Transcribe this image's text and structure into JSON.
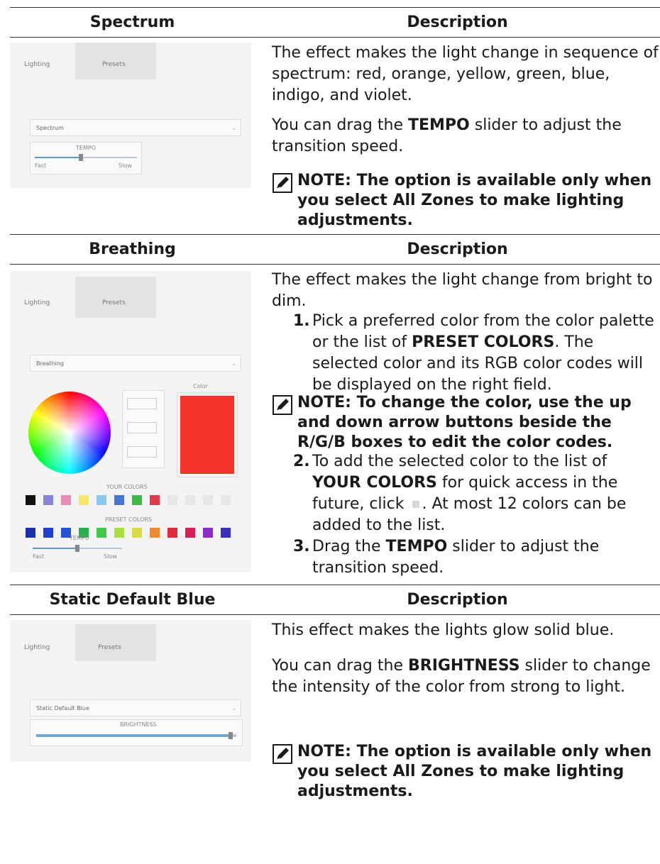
{
  "sections": [
    {
      "header_left": "Spectrum",
      "header_right": "Description",
      "screenshot": {
        "tab1": "Lighting",
        "tab2": "Presets",
        "dropdown": "Spectrum",
        "slider_label": "TEMPO",
        "slider_min": "Fast",
        "slider_max": "Slow",
        "slider_value": 0.45
      },
      "paragraphs": [
        "The effect makes the light change in sequence of spectrum: red, orange, yellow, green, blue, indigo, and violet."
      ],
      "tempo": {
        "before": "You can drag the ",
        "bold": "TEMPO",
        "after": " slider to adjust the transition speed."
      },
      "note": "NOTE: The option is available only when you select All Zones to make lighting adjustments."
    },
    {
      "header_left": "Breathing",
      "header_right": "Description",
      "screenshot": {
        "tab1": "Lighting",
        "tab2": "Presets",
        "dropdown": "Breathing",
        "swatch_label": "Color",
        "preset_label": "PRESET COLORS",
        "your_label": "YOUR COLORS",
        "slider_label": "TEMPO",
        "slider_min": "Fast",
        "slider_max": "Slow",
        "slider_value": 0.5,
        "selected_color": "#f5332b",
        "your_colors": [
          "#111111",
          "#8a84d8",
          "#e98cb8",
          "#f5e76a",
          "#8bc7ee",
          "#4a75d8",
          "#3fb84a",
          "#e4384a",
          "#e7e7e7",
          "#e7e7e7",
          "#e7e7e7",
          "#e7e7e7"
        ],
        "preset_colors": [
          "#1a2fae",
          "#1f3fcf",
          "#2453d8",
          "#23b24c",
          "#40c84a",
          "#a7e03a",
          "#d8dc43",
          "#f08a2e",
          "#e2283b",
          "#d61f54",
          "#8b2bc9",
          "#3a2fbf"
        ]
      },
      "paragraphs": [
        "The effect makes the light change from bright to dim."
      ],
      "step1": {
        "num": "1.",
        "before": "Pick a preferred color from the color palette or the list of ",
        "bold": "PRESET COLORS",
        "after": ". The selected color and its RGB color codes will be displayed on the right field."
      },
      "note": "NOTE: To change the color, use the up and down arrow buttons beside the R/G/B boxes to edit the color codes.",
      "step2": {
        "num": "2.",
        "before": "To add the selected color to the list of ",
        "bold": "YOUR COLORS",
        "middle": " for quick access in the future, click ",
        "after": ". At most 12 colors can be added to the list."
      },
      "step3": {
        "num": "3.",
        "before": "Drag the ",
        "bold": "TEMPO",
        "after": " slider to adjust the transition speed."
      }
    },
    {
      "header_left": "Static Default Blue",
      "header_right": "Description",
      "screenshot": {
        "tab1": "Lighting",
        "tab2": "Presets",
        "dropdown": "Static Default Blue",
        "slider_label": "BRIGHTNESS",
        "slider_value": 0.97
      },
      "paragraphs": [
        "This effect makes the lights glow solid blue."
      ],
      "brightness": {
        "before": "You can drag the ",
        "bold": "BRIGHTNESS",
        "after": " slider to change the intensity of the color from strong to light."
      },
      "note": "NOTE: The option is available only when you select All Zones to make lighting adjustments."
    }
  ]
}
